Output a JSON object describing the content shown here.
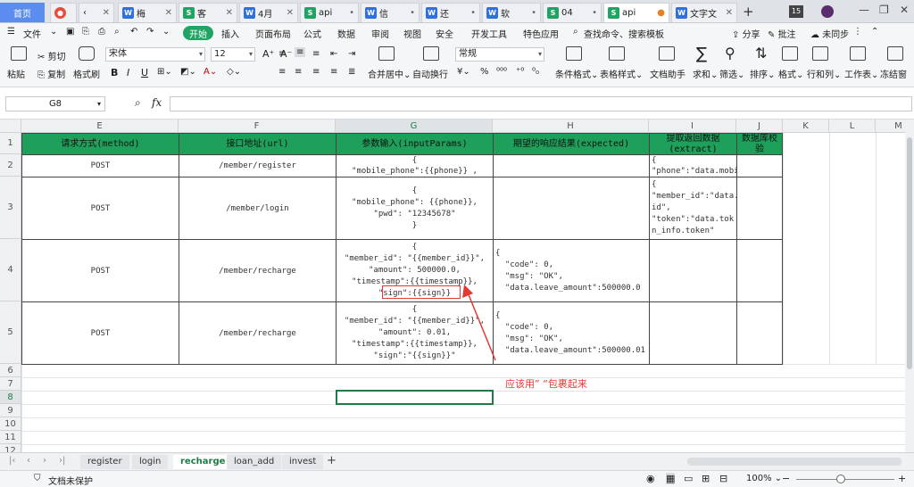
{
  "tabs": [
    {
      "label": "首页",
      "icon": "none"
    },
    {
      "label": "",
      "icon": "pdf"
    },
    {
      "label": "",
      "icon": "back"
    },
    {
      "label": "梅",
      "icon": "w"
    },
    {
      "label": "客",
      "icon": "w"
    },
    {
      "label": "4月",
      "icon": "s"
    },
    {
      "label": "api",
      "icon": "s"
    },
    {
      "label": "信",
      "icon": "w"
    },
    {
      "label": "还",
      "icon": "w"
    },
    {
      "label": "软",
      "icon": "w"
    },
    {
      "label": "04",
      "icon": "s"
    },
    {
      "label": "api",
      "icon": "s"
    },
    {
      "label": "文字文",
      "icon": "w"
    }
  ],
  "tab_badge": "15",
  "menu": {
    "file": "文件",
    "start": "开始",
    "items": [
      "插入",
      "页面布局",
      "公式",
      "数据",
      "审阅",
      "视图",
      "安全",
      "开发工具",
      "特色应用"
    ],
    "search": "查找命令、搜索模板",
    "share": "分享",
    "comment": "批注",
    "sync": "未同步"
  },
  "ribbon": {
    "paste": "粘贴",
    "cut": "剪切",
    "copy": "复制",
    "format_painter": "格式刷",
    "font": "宋体",
    "size": "12",
    "number_format": "常规",
    "merge": "合并居中",
    "wrap": "自动换行",
    "cond_format": "条件格式",
    "table_style": "表格样式",
    "doc_helper": "文档助手",
    "sum": "求和",
    "filter": "筛选",
    "sort": "排序",
    "format": "格式",
    "rowcol": "行和列",
    "sheet": "工作表",
    "freeze": "冻结窗"
  },
  "namebox": "G8",
  "fx": "fx",
  "columns": [
    "E",
    "F",
    "G",
    "H",
    "I",
    "J",
    "K",
    "L",
    "M"
  ],
  "rows": [
    "1",
    "2",
    "3",
    "4",
    "5",
    "6",
    "7",
    "8",
    "9",
    "10",
    "11",
    "12"
  ],
  "headers": {
    "E": "请求方式(method)",
    "F": "接口地址(url)",
    "G": "参数输入(inputParams)",
    "H": "期望的响应结果(expected)",
    "I": "提取返回数据\n(extract)",
    "J": "数据库校\n验"
  },
  "r2": {
    "E": "POST",
    "F": "/member/register",
    "G": "{\n\"mobile_phone\":{{phone}} ,",
    "H": "",
    "I": "{\n\"phone\":\"data.mobi"
  },
  "r3": {
    "E": "POST",
    "F": "/member/login",
    "G": "{\n\"mobile_phone\": {{phone}},\n\"pwd\": \"12345678\"\n}",
    "H": "",
    "I": "{\n\"member_id\":\"data.\nid\",\n\"token\":\"data.tok\nn_info.token\""
  },
  "r4": {
    "E": "POST",
    "F": "/member/recharge",
    "G": "{\n\"member_id\": \"{{member_id}}\",\n\"amount\": 500000.0,\n\"timestamp\":{{timestamp}},\n\"sign\":{{sign}}",
    "H": "{\n  \"code\": 0,\n  \"msg\": \"OK\",\n  \"data.leave_amount\":500000.0"
  },
  "r5": {
    "E": "POST",
    "F": "/member/recharge",
    "G": "{\n\"member_id\": \"{{member_id}}\",\n\"amount\": 0.01,\n\"timestamp\":{{timestamp}},\n\"sign\":\"{{sign}}\"",
    "H": "{\n  \"code\": 0,\n  \"msg\": \"OK\",\n  \"data.leave_amount\":500000.01"
  },
  "annotation": "应该用”  “包裹起来",
  "sheets": [
    "register",
    "login",
    "recharge",
    "loan_add",
    "invest"
  ],
  "active_sheet": "recharge",
  "status": {
    "protect": "文档未保护",
    "zoom": "100%"
  },
  "colors": {
    "header_green": "#1e9f5a",
    "annotation_red": "#e53935",
    "accent": "#1fa463"
  }
}
